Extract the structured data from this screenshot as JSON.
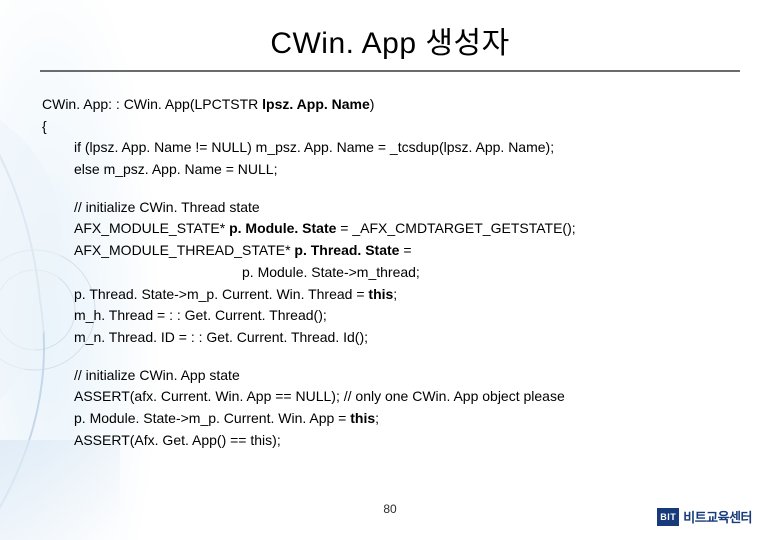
{
  "title": "CWin. App 생성자",
  "code": {
    "p1": {
      "l1a": "CWin. App: : CWin. App(LPCTSTR ",
      "l1b": "lpsz. App. Name",
      "l1c": ")",
      "l2": "{",
      "l3": "if (lpsz. App. Name != NULL) m_psz. App. Name = _tcsdup(lpsz. App. Name);",
      "l4": "else m_psz. App. Name = NULL;"
    },
    "p2": {
      "l1": "// initialize CWin. Thread state",
      "l2a": "AFX_MODULE_STATE* ",
      "l2b": "p. Module. State",
      "l2c": " = _AFX_CMDTARGET_GETSTATE();",
      "l3a": "AFX_MODULE_THREAD_STATE* ",
      "l3b": "p. Thread. State",
      "l3c": " =",
      "l4": "p. Module. State->m_thread;",
      "l5a": "p. Thread. State->m_p. Current. Win. Thread = ",
      "l5b": "this",
      "l5c": ";",
      "l6": "m_h. Thread = : : Get. Current. Thread();",
      "l7": "m_n. Thread. ID = : : Get. Current. Thread. Id();"
    },
    "p3": {
      "l1": "// initialize CWin. App state",
      "l2": "ASSERT(afx. Current. Win. App == NULL); // only one CWin. App object please",
      "l3a": "p. Module. State->m_p. Current. Win. App = ",
      "l3b": "this",
      "l3c": ";",
      "l4": "ASSERT(Afx. Get. App() == this);"
    }
  },
  "footer": {
    "page": "80",
    "brand_box": "BIT",
    "brand_text": "비트교육센터"
  }
}
